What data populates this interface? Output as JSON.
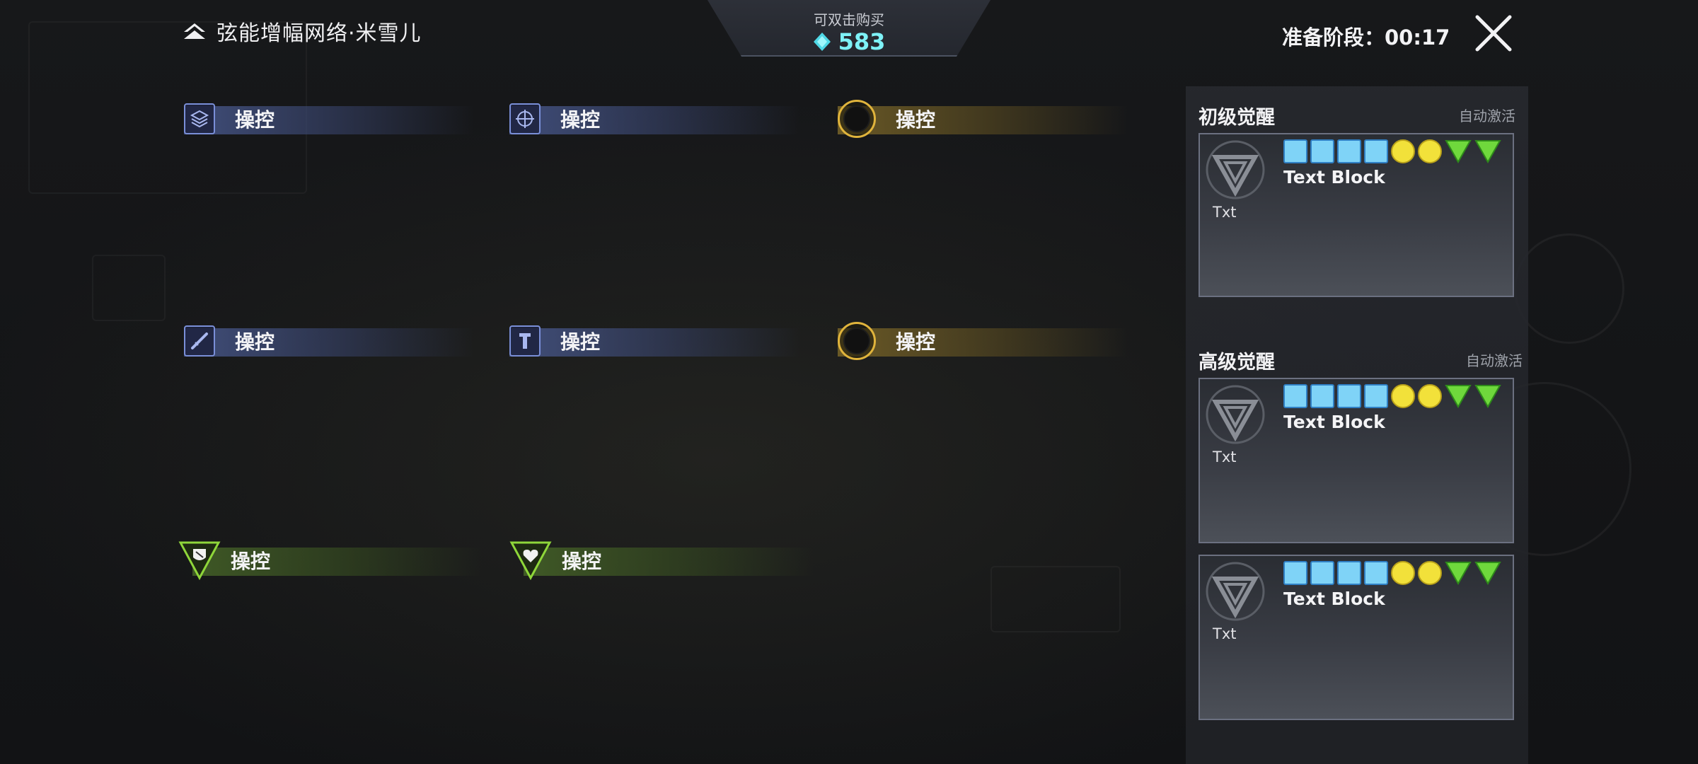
{
  "header": {
    "title": "弦能增幅网络·米雪儿",
    "title_icon": "chevron-up-icon"
  },
  "purchase": {
    "hint": "可双击购买",
    "amount": "583",
    "currency_icon": "diamond-currency-icon",
    "currency_color": "#7ef2f7"
  },
  "timer": {
    "text": "准备阶段：00:17"
  },
  "close": {
    "icon": "close-icon"
  },
  "skills": [
    {
      "label": "操控",
      "style": "blue",
      "icon": "stack-icon"
    },
    {
      "label": "操控",
      "style": "blue",
      "icon": "crosshair-icon"
    },
    {
      "label": "操控",
      "style": "gold",
      "icon": "ring-icon"
    },
    {
      "label": "操控",
      "style": "blue",
      "icon": "blade-icon"
    },
    {
      "label": "操控",
      "style": "blue",
      "icon": "pillar-icon"
    },
    {
      "label": "操控",
      "style": "gold",
      "icon": "ring-icon"
    },
    {
      "label": "操控",
      "style": "green",
      "icon": "shield-icon"
    },
    {
      "label": "操控",
      "style": "green",
      "icon": "heart-icon"
    }
  ],
  "colors": {
    "blue_accent": "#7a8fd8",
    "gold_accent": "#e0b43c",
    "green_accent": "#8fd63a",
    "pip_square": "#7fd3f7",
    "pip_circle": "#f2e13a",
    "pip_triangle": "#6fd83c"
  },
  "awaken": {
    "basic": {
      "title": "初级觉醒",
      "auto": "自动激活",
      "cards": [
        {
          "title": "Text Block",
          "text": "Txt"
        }
      ]
    },
    "advanced": {
      "title": "高级觉醒",
      "auto": "自动激活",
      "cards": [
        {
          "title": "Text Block",
          "text": "Txt"
        },
        {
          "title": "Text Block",
          "text": "Txt"
        }
      ]
    }
  }
}
